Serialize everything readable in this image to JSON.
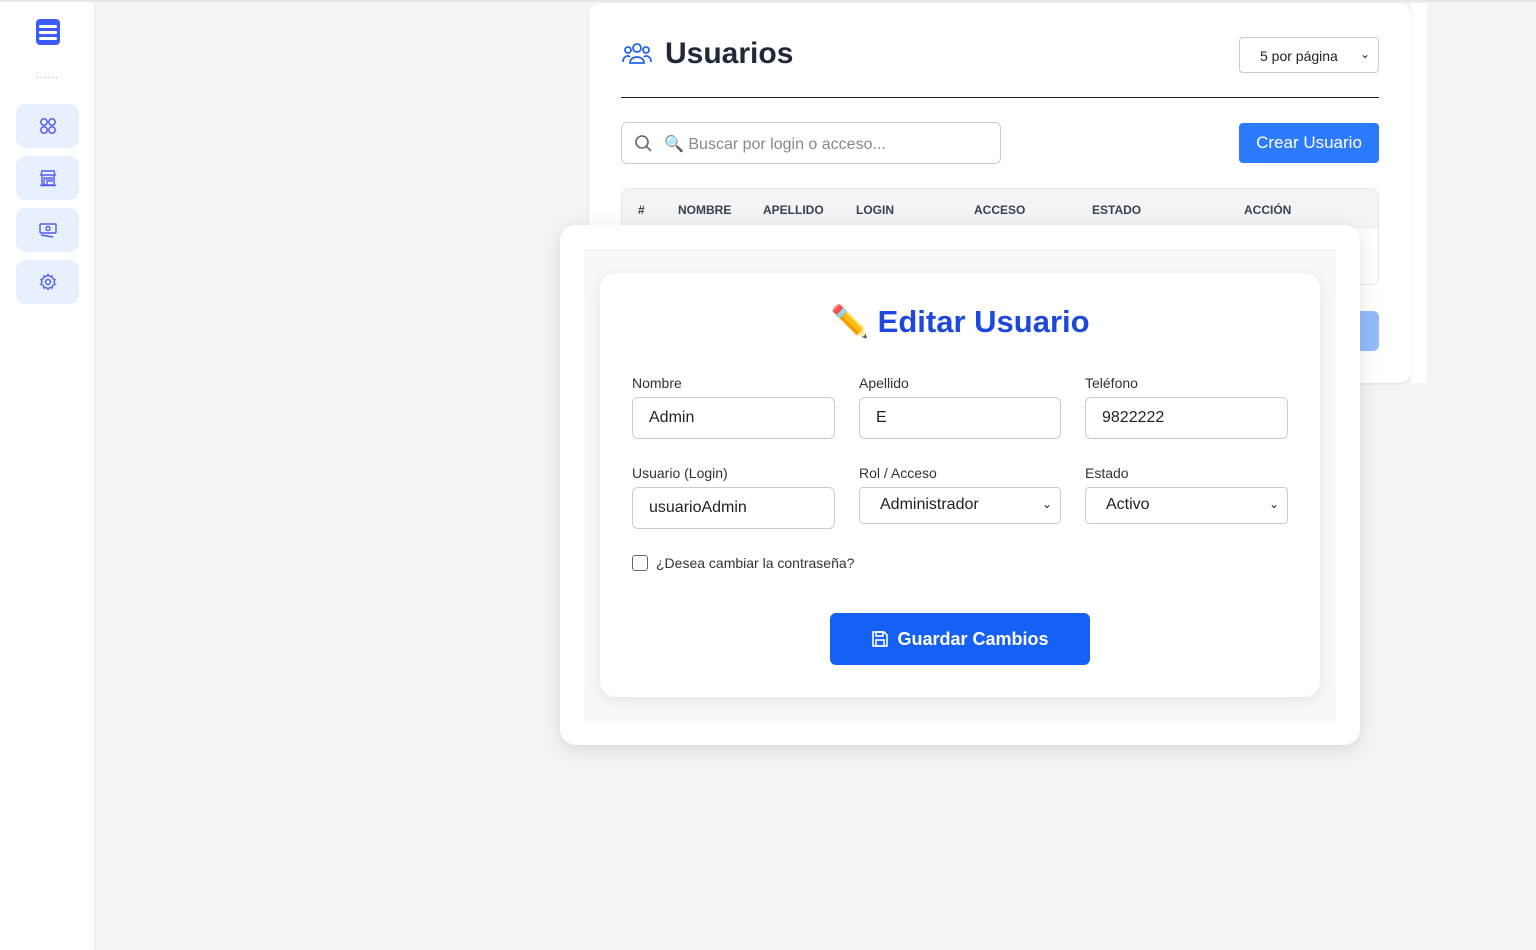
{
  "sidebar": {
    "dots": "......",
    "items": [
      {
        "icon": "grid-icon"
      },
      {
        "icon": "store-icon"
      },
      {
        "icon": "money-icon"
      },
      {
        "icon": "gear-icon"
      }
    ]
  },
  "users": {
    "title": "Usuarios",
    "per_page": "5 por página",
    "search_placeholder": "🔍 Buscar por login o acceso...",
    "create_label": "Crear Usuario",
    "columns": [
      "#",
      "NOMBRE",
      "APELLIDO",
      "LOGIN",
      "ACCESO",
      "ESTADO",
      "ACCIÓN"
    ]
  },
  "modal": {
    "title": "Editar Usuario",
    "title_icon": "✏️",
    "fields": {
      "nombre": {
        "label": "Nombre",
        "value": "Admin"
      },
      "apellido": {
        "label": "Apellido",
        "value": "E"
      },
      "telefono": {
        "label": "Teléfono",
        "value": "9822222"
      },
      "login": {
        "label": "Usuario (Login)",
        "value": "usuarioAdmin"
      },
      "rol": {
        "label": "Rol / Acceso",
        "value": "Administrador"
      },
      "estado": {
        "label": "Estado",
        "value": "Activo"
      }
    },
    "change_password": "¿Desea cambiar la contraseña?",
    "save_label": "Guardar Cambios"
  },
  "colors": {
    "accent": "#1560f5",
    "title": "#1d48e0",
    "sidebar_btn": "#e8efff"
  }
}
